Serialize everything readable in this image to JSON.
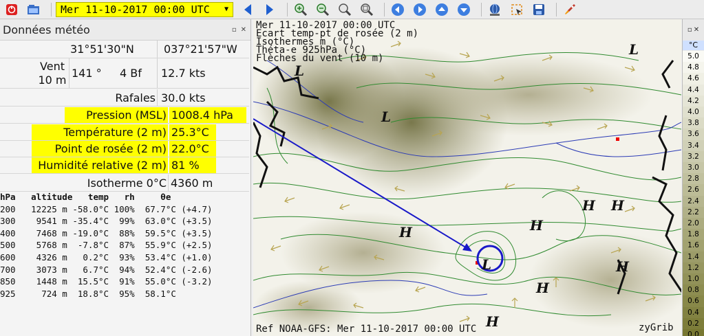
{
  "toolbar": {
    "date_value": "Mer 11-10-2017 00:00 UTC",
    "buttons": [
      "quit-icon",
      "open-file-icon",
      "previous-icon",
      "next-icon",
      "zoom-in-icon",
      "zoom-out-icon",
      "zoom-selection-icon",
      "zoom-all-icon",
      "scroll-left-icon",
      "scroll-right-icon",
      "scroll-up-icon",
      "scroll-down-icon",
      "download-icon",
      "select-zone-icon",
      "save-icon",
      "rocket-icon"
    ]
  },
  "panel": {
    "title": "Données météo",
    "latitude": "31°51'30\"N",
    "longitude": "037°21'57\"W",
    "wind": {
      "label_line1": "Vent",
      "label_line2": "10 m",
      "direction": "141 °",
      "beaufort": "4 Bf",
      "speed": "12.7  kts"
    },
    "rows": [
      {
        "label": "Rafales",
        "value": "30.0  kts",
        "highlight": false
      },
      {
        "label": "Pression (MSL)",
        "value": "1008.4 hPa",
        "highlight": true
      },
      {
        "label": "Température (2 m)",
        "value": "25.3°C",
        "highlight": true
      },
      {
        "label": "Point de rosée (2 m)",
        "value": "22.0°C",
        "highlight": true
      },
      {
        "label": "Humidité relative (2 m)",
        "value": "81 %",
        "highlight": true
      },
      {
        "label": "Isotherme 0°C",
        "value": "4360 m",
        "highlight": false
      }
    ],
    "sounding": {
      "header": "hPa   altitude   temp   rh     θe",
      "rows": [
        "200   12225 m -58.0°C 100%  67.7°C (+4.7)",
        "300    9541 m -35.4°C  99%  63.0°C (+3.5)",
        "400    7468 m -19.0°C  88%  59.5°C (+3.5)",
        "500    5768 m  -7.8°C  87%  55.9°C (+2.5)",
        "600    4326 m   0.2°C  93%  53.4°C (+1.0)",
        "700    3073 m   6.7°C  94%  52.4°C (-2.6)",
        "850    1448 m  15.5°C  91%  55.0°C (-3.2)",
        "925     724 m  18.8°C  95%  58.1°C"
      ]
    }
  },
  "map": {
    "header_lines": [
      "Mer 11-10-2017 00:00 UTC",
      "Ecart temp-pt de rosée (2 m)",
      "Isothermes  m (°C)",
      "Théta-e 925hPa (°C)",
      "Flèches du vent (10 m)"
    ],
    "footer": "Ref NOAA-GFS: Mer 11-10-2017 00:00 UTC",
    "brand": "zyGrib",
    "pressure_labels": [
      "L",
      "L",
      "L",
      "H",
      "H",
      "H",
      "H",
      "H",
      "H",
      "H",
      "L"
    ]
  },
  "legend": {
    "unit": "°C",
    "values": [
      "5.0",
      "4.8",
      "4.6",
      "4.4",
      "4.2",
      "4.0",
      "3.8",
      "3.6",
      "3.4",
      "3.2",
      "3.0",
      "2.8",
      "2.6",
      "2.4",
      "2.2",
      "2.0",
      "1.8",
      "1.6",
      "1.4",
      "1.2",
      "1.0",
      "0.8",
      "0.6",
      "0.4",
      "0.2",
      "0.0"
    ]
  }
}
